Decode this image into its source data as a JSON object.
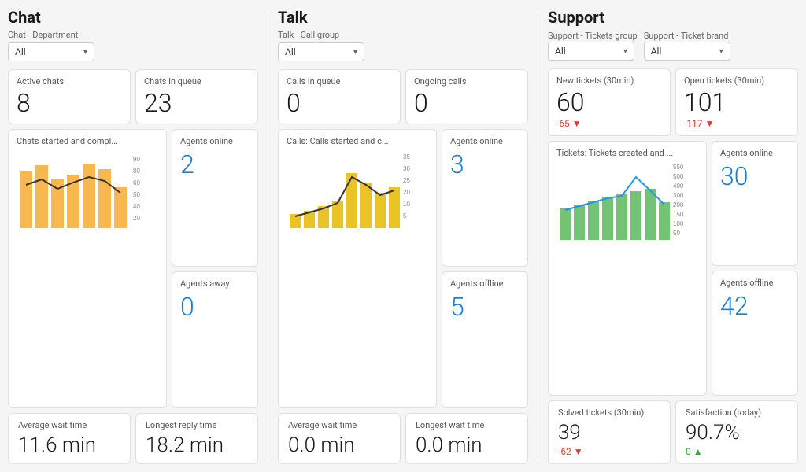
{
  "sections": {
    "chat": {
      "title": "Chat",
      "filter_label": "Chat - Department",
      "dropdown_value": "All",
      "active_chats_label": "Active chats",
      "active_chats_value": "8",
      "chats_queue_label": "Chats in queue",
      "chats_queue_value": "23",
      "agents_online_label": "Agents online",
      "agents_online_value": "2",
      "agents_away_label": "Agents away",
      "agents_away_value": "0",
      "chart_label": "Chats started and compl...",
      "avg_wait_label": "Average wait time",
      "avg_wait_value": "11.6 min",
      "longest_reply_label": "Longest reply time",
      "longest_reply_value": "18.2 min"
    },
    "talk": {
      "title": "Talk",
      "filter_label": "Talk - Call group",
      "dropdown_value": "All",
      "calls_queue_label": "Calls in queue",
      "calls_queue_value": "0",
      "ongoing_calls_label": "Ongoing calls",
      "ongoing_calls_value": "0",
      "agents_online_label": "Agents online",
      "agents_online_value": "3",
      "agents_offline_label": "Agents offline",
      "agents_offline_value": "5",
      "chart_label": "Calls: Calls started and c...",
      "avg_wait_label": "Average wait time",
      "avg_wait_value": "0.0 min",
      "longest_wait_label": "Longest wait time",
      "longest_wait_value": "0.0 min"
    },
    "support": {
      "title": "Support",
      "filter_label_group": "Support - Tickets group",
      "filter_label_brand": "Support - Ticket brand",
      "dropdown_group": "All",
      "dropdown_brand": "All",
      "new_tickets_label": "New tickets (30min)",
      "new_tickets_value": "60",
      "new_tickets_delta": "-65 ▼",
      "open_tickets_label": "Open tickets (30min)",
      "open_tickets_value": "101",
      "open_tickets_delta": "-117 ▼",
      "agents_online_label": "Agents online",
      "agents_online_value": "30",
      "agents_offline_label": "Agents offline",
      "agents_offline_value": "42",
      "chart_label": "Tickets: Tickets created and ...",
      "solved_label": "Solved tickets (30min)",
      "solved_value": "39",
      "solved_delta": "-62 ▼",
      "satisfaction_label": "Satisfaction (today)",
      "satisfaction_value": "90.7%",
      "satisfaction_delta": "0 ▲"
    }
  }
}
